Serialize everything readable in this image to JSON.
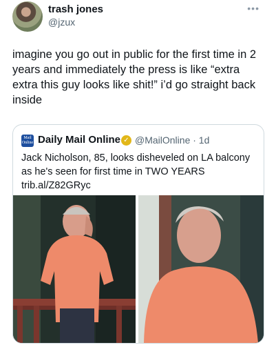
{
  "tweet": {
    "author_name": "trash jones",
    "author_handle": "@jzux",
    "more_icon": "ellipsis-icon",
    "text": "imagine you go out in public for the first time in 2 years and immediately the press is like “extra extra this guy looks like shit!” i’d go straight back inside"
  },
  "quoted_tweet": {
    "logo_text": "Mail Online",
    "author_name": "Daily Mail Online",
    "verified_icon": "gold-verified-badge-icon",
    "author_handle": "@MailOnline · 1d",
    "text": "Jack Nicholson, 85, looks disheveled on LA balcony as he's seen for first time in TWO YEARS trib.al/Z82GRyc"
  },
  "colors": {
    "text": "#0f1419",
    "secondary": "#536471",
    "border": "#cfd9de",
    "shirt": "#ec8a6c",
    "badge": "#e2b719"
  }
}
